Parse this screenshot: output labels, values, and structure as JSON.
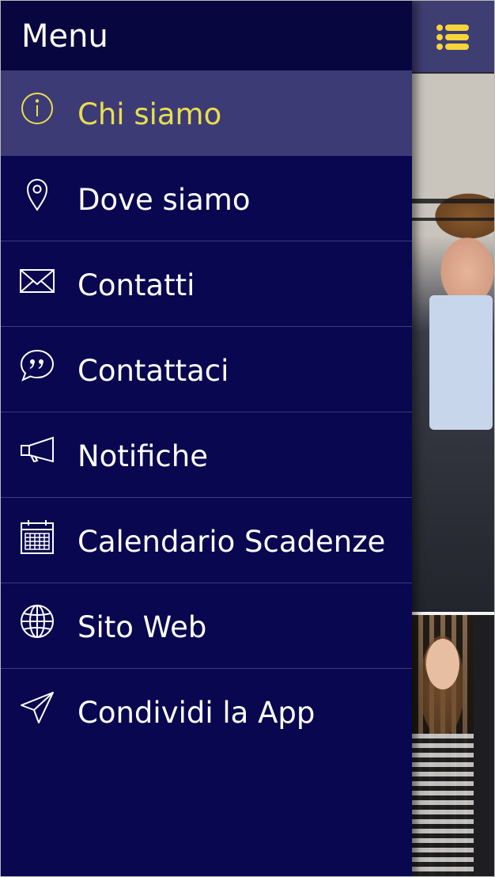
{
  "drawer": {
    "title": "Menu",
    "items": [
      {
        "label": "Chi siamo",
        "icon": "info-icon",
        "active": true
      },
      {
        "label": "Dove siamo",
        "icon": "location-pin-icon",
        "active": false
      },
      {
        "label": "Contatti",
        "icon": "envelope-icon",
        "active": false
      },
      {
        "label": "Contattaci",
        "icon": "quote-bubble-icon",
        "active": false
      },
      {
        "label": "Notifiche",
        "icon": "megaphone-icon",
        "active": false
      },
      {
        "label": "Calendario Scadenze",
        "icon": "calendar-icon",
        "active": false
      },
      {
        "label": "Sito Web",
        "icon": "globe-icon",
        "active": false
      },
      {
        "label": "Condividi la App",
        "icon": "paper-plane-icon",
        "active": false
      }
    ]
  },
  "header": {
    "menu_icon": "list-menu-icon"
  },
  "colors": {
    "drawer_bg": "#09074f",
    "drawer_header_bg": "#07063f",
    "active_bg": "#3d3b75",
    "active_text": "#e8de4e",
    "text": "#ffffff",
    "accent_yellow": "#f5d53a",
    "app_header": "#3f3e72"
  }
}
